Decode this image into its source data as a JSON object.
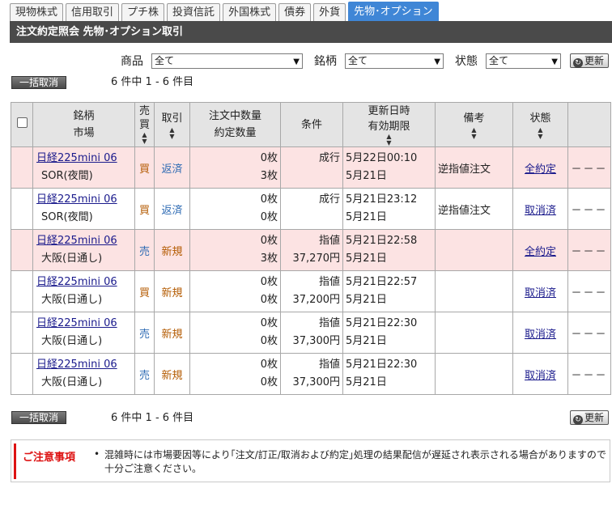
{
  "tabs": [
    {
      "label": "現物株式",
      "active": false
    },
    {
      "label": "信用取引",
      "active": false
    },
    {
      "label": "プチ株",
      "active": false
    },
    {
      "label": "投資信託",
      "active": false
    },
    {
      "label": "外国株式",
      "active": false
    },
    {
      "label": "債券",
      "active": false
    },
    {
      "label": "外貨",
      "active": false
    },
    {
      "label": "先物･オプション",
      "active": true
    }
  ],
  "title": "注文約定照会 先物･オプション取引",
  "filters": {
    "product_label": "商品",
    "product_value": "全て",
    "brand_label": "銘柄",
    "brand_value": "全て",
    "status_label": "状態",
    "status_value": "全て"
  },
  "refresh_label": "更新",
  "bulk_cancel_label": "一括取消",
  "count_text": "6 件中 1 - 6 件目",
  "table": {
    "headers": {
      "name": "銘柄",
      "market": "市場",
      "side_1": "売",
      "side_2": "買",
      "type": "取引",
      "qty_1": "注文中数量",
      "qty_2": "約定数量",
      "cond": "条件",
      "date_1": "更新日時",
      "date_2": "有効期限",
      "note": "備考",
      "status": "状態"
    },
    "rows": [
      {
        "name": "日経225mini 06",
        "market": "SOR(夜間)",
        "side": "買",
        "side_kind": "buy",
        "type": "返済",
        "type_kind": "close",
        "qty_open": "0枚",
        "qty_filled": "3枚",
        "cond_type": "成行",
        "cond_price": "",
        "updated": "5月22日00:10",
        "expiry": "5月21日",
        "note": "逆指値注文",
        "status": "全約定",
        "last": "－－－",
        "highlight": true
      },
      {
        "name": "日経225mini 06",
        "market": "SOR(夜間)",
        "side": "買",
        "side_kind": "buy",
        "type": "返済",
        "type_kind": "close",
        "qty_open": "0枚",
        "qty_filled": "0枚",
        "cond_type": "成行",
        "cond_price": "",
        "updated": "5月21日23:12",
        "expiry": "5月21日",
        "note": "逆指値注文",
        "status": "取消済",
        "last": "－－－",
        "highlight": false
      },
      {
        "name": "日経225mini 06",
        "market": "大阪(日通し)",
        "side": "売",
        "side_kind": "sell",
        "type": "新規",
        "type_kind": "new",
        "qty_open": "0枚",
        "qty_filled": "3枚",
        "cond_type": "指値",
        "cond_price": "37,270円",
        "updated": "5月21日22:58",
        "expiry": "5月21日",
        "note": "",
        "status": "全約定",
        "last": "－－－",
        "highlight": true
      },
      {
        "name": "日経225mini 06",
        "market": "大阪(日通し)",
        "side": "買",
        "side_kind": "buy",
        "type": "新規",
        "type_kind": "new",
        "qty_open": "0枚",
        "qty_filled": "0枚",
        "cond_type": "指値",
        "cond_price": "37,200円",
        "updated": "5月21日22:57",
        "expiry": "5月21日",
        "note": "",
        "status": "取消済",
        "last": "－－－",
        "highlight": false
      },
      {
        "name": "日経225mini 06",
        "market": "大阪(日通し)",
        "side": "売",
        "side_kind": "sell",
        "type": "新規",
        "type_kind": "new",
        "qty_open": "0枚",
        "qty_filled": "0枚",
        "cond_type": "指値",
        "cond_price": "37,300円",
        "updated": "5月21日22:30",
        "expiry": "5月21日",
        "note": "",
        "status": "取消済",
        "last": "－－－",
        "highlight": false
      },
      {
        "name": "日経225mini 06",
        "market": "大阪(日通し)",
        "side": "売",
        "side_kind": "sell",
        "type": "新規",
        "type_kind": "new",
        "qty_open": "0枚",
        "qty_filled": "0枚",
        "cond_type": "指値",
        "cond_price": "37,300円",
        "updated": "5月21日22:30",
        "expiry": "5月21日",
        "note": "",
        "status": "取消済",
        "last": "－－－",
        "highlight": false
      }
    ]
  },
  "notice": {
    "title": "ご注意事項",
    "bullet": "•",
    "text": "混雑時には市場要因等により｢注文/訂正/取消および約定｣処理の結果配信が遅延され表示される場合がありますので十分ご注意ください。"
  },
  "icons": {
    "refresh": "refresh-icon",
    "sort": "sort-arrows-icon",
    "dropdown": "chevron-down-icon"
  }
}
